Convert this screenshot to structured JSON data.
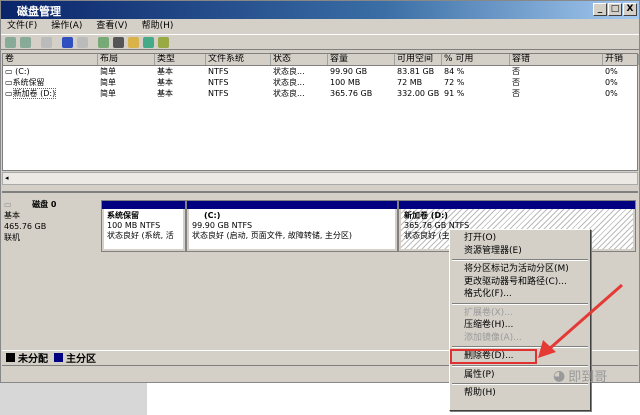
{
  "window": {
    "title": "磁盘管理",
    "min": "_",
    "max": "□",
    "close": "X"
  },
  "menu": [
    "文件(F)",
    "操作(A)",
    "查看(V)",
    "帮助(H)"
  ],
  "table": {
    "headers": [
      "卷",
      "布局",
      "类型",
      "文件系统",
      "状态",
      "容量",
      "可用空间",
      "% 可用",
      "容错",
      "开销"
    ],
    "rows": [
      [
        "(C:)",
        "简单",
        "基本",
        "NTFS",
        "状态良...",
        "99.90 GB",
        "83.81 GB",
        "84 %",
        "否",
        "0%"
      ],
      [
        "系统保留",
        "简单",
        "基本",
        "NTFS",
        "状态良...",
        "100 MB",
        "72 MB",
        "72 %",
        "否",
        "0%"
      ],
      [
        "新加卷 (D:)",
        "简单",
        "基本",
        "NTFS",
        "状态良...",
        "365.76 GB",
        "332.00 GB",
        "91 %",
        "否",
        "0%"
      ]
    ]
  },
  "disk": {
    "name": "磁盘 0",
    "type": "基本",
    "size": "465.76 GB",
    "status": "联机",
    "partitions": [
      {
        "name": "系统保留",
        "info": "100 MB NTFS",
        "status": "状态良好 (系统, 活"
      },
      {
        "name": "(C:)",
        "info": "99.90 GB NTFS",
        "status": "状态良好 (启动, 页面文件, 故障转储, 主分区)"
      },
      {
        "name": "新加卷 (D:)",
        "info": "365.76 GB NTFS",
        "status": "状态良好 (主分区)"
      }
    ]
  },
  "legend": {
    "unallocated": "未分配",
    "primary": "主分区",
    "unallocated_color": "#000000",
    "primary_color": "#000080"
  },
  "context_menu": {
    "open": "打开(O)",
    "explorer": "资源管理器(E)",
    "mark_active": "将分区标记为活动分区(M)",
    "change_letter": "更改驱动器号和路径(C)...",
    "format": "格式化(F)...",
    "extend": "扩展卷(X)...",
    "shrink": "压缩卷(H)...",
    "add_mirror": "添加镜像(A)...",
    "delete": "删除卷(D)...",
    "properties": "属性(P)",
    "help": "帮助(H)"
  },
  "watermark": "即到哥"
}
